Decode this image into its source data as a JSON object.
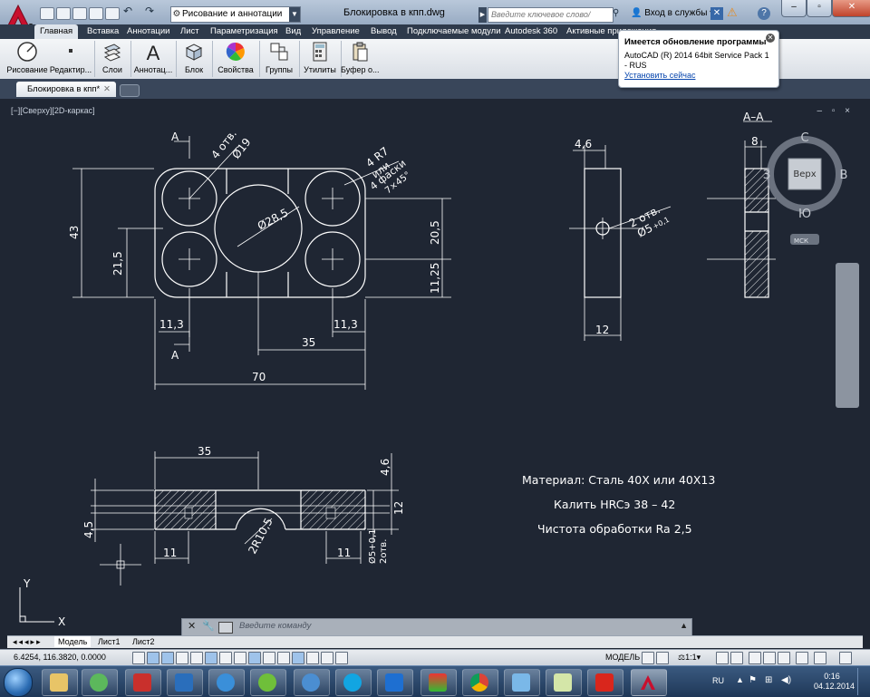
{
  "app": {
    "workspace": "Рисование и аннотации",
    "doc_title": "Блокировка в кпп.dwg",
    "search_placeholder": "Введите ключевое слово/фразу",
    "signin": "Вход в службы"
  },
  "ribbon": {
    "tabs": [
      "Главная",
      "Вставка",
      "Аннотации",
      "Лист",
      "Параметризация",
      "Вид",
      "Управление",
      "Вывод",
      "Подключаемые модули",
      "Autodesk 360",
      "Активные приложения"
    ],
    "buttons": [
      "Рисование",
      "Редактир...",
      "Слои",
      "Аннотац...",
      "Блок",
      "Свойства",
      "Группы",
      "Утилиты",
      "Буфер о..."
    ]
  },
  "notification": {
    "title": "Имеется обновление программы",
    "body": "AutoCAD (R) 2014 64bit Service Pack 1 - RUS",
    "link": "Установить сейчас"
  },
  "file_tab": "Блокировка в кпп*",
  "viewport": {
    "label": "[−][Сверху][2D-каркас]",
    "controls": "– ▫ ×"
  },
  "viewcube": {
    "top": "Верх",
    "n": "С",
    "s": "Ю",
    "e": "В",
    "w": "З",
    "ucs": "МСК"
  },
  "drawing": {
    "section_a": "А",
    "holes_4": "4 отв.",
    "hole_dia": "Ø19",
    "r7": "4 R7",
    "ili": "или",
    "chamfers": "4 фаски",
    "chamfer_size": "7×45°",
    "dia_center": "Ø28,5",
    "dim_43": "43",
    "dim_215": "21,5",
    "dim_205": "20,5",
    "dim_1125": "11,25",
    "dim_113a": "11,3",
    "dim_113b": "11,3",
    "dim_35a": "35",
    "dim_70": "70",
    "dim_46a": "4,6",
    "holes_2": "2 отв.",
    "dia_5": "Ø5",
    "tol_5": "+0,1",
    "dim_12a": "12",
    "section_aa": "А–А",
    "dim_8": "8",
    "dim_35b": "35",
    "dim_46b": "4,6",
    "dim_12b": "12",
    "dim_45": "4,5",
    "dim_11a": "11",
    "dim_11b": "11",
    "r105": "2R10,5",
    "dia_5b": "Ø5+0,1",
    "holes_2b": "2отв.",
    "material": "Материал: Сталь 40Х или 40Х13",
    "hardening": "Калить HRCэ 38 – 42",
    "finish": "Чистота обработки Ra 2,5",
    "ucs_y": "Y",
    "ucs_x": "X"
  },
  "command_line": {
    "placeholder": "Введите команду"
  },
  "layout_tabs": [
    "Модель",
    "Лист1",
    "Лист2"
  ],
  "status": {
    "coords": "6.4254, 116.3820, 0.0000",
    "model": "МОДЕЛЬ",
    "scale": "1:1"
  },
  "taskbar": {
    "lang": "RU",
    "time": "0:16",
    "date": "04.12.2014"
  },
  "colors": {
    "drawing_bg": "#1f2633",
    "line": "#ffffff",
    "ribbon_tabs_bg": "#2e3a4b",
    "acad_red": "#c8102e"
  }
}
